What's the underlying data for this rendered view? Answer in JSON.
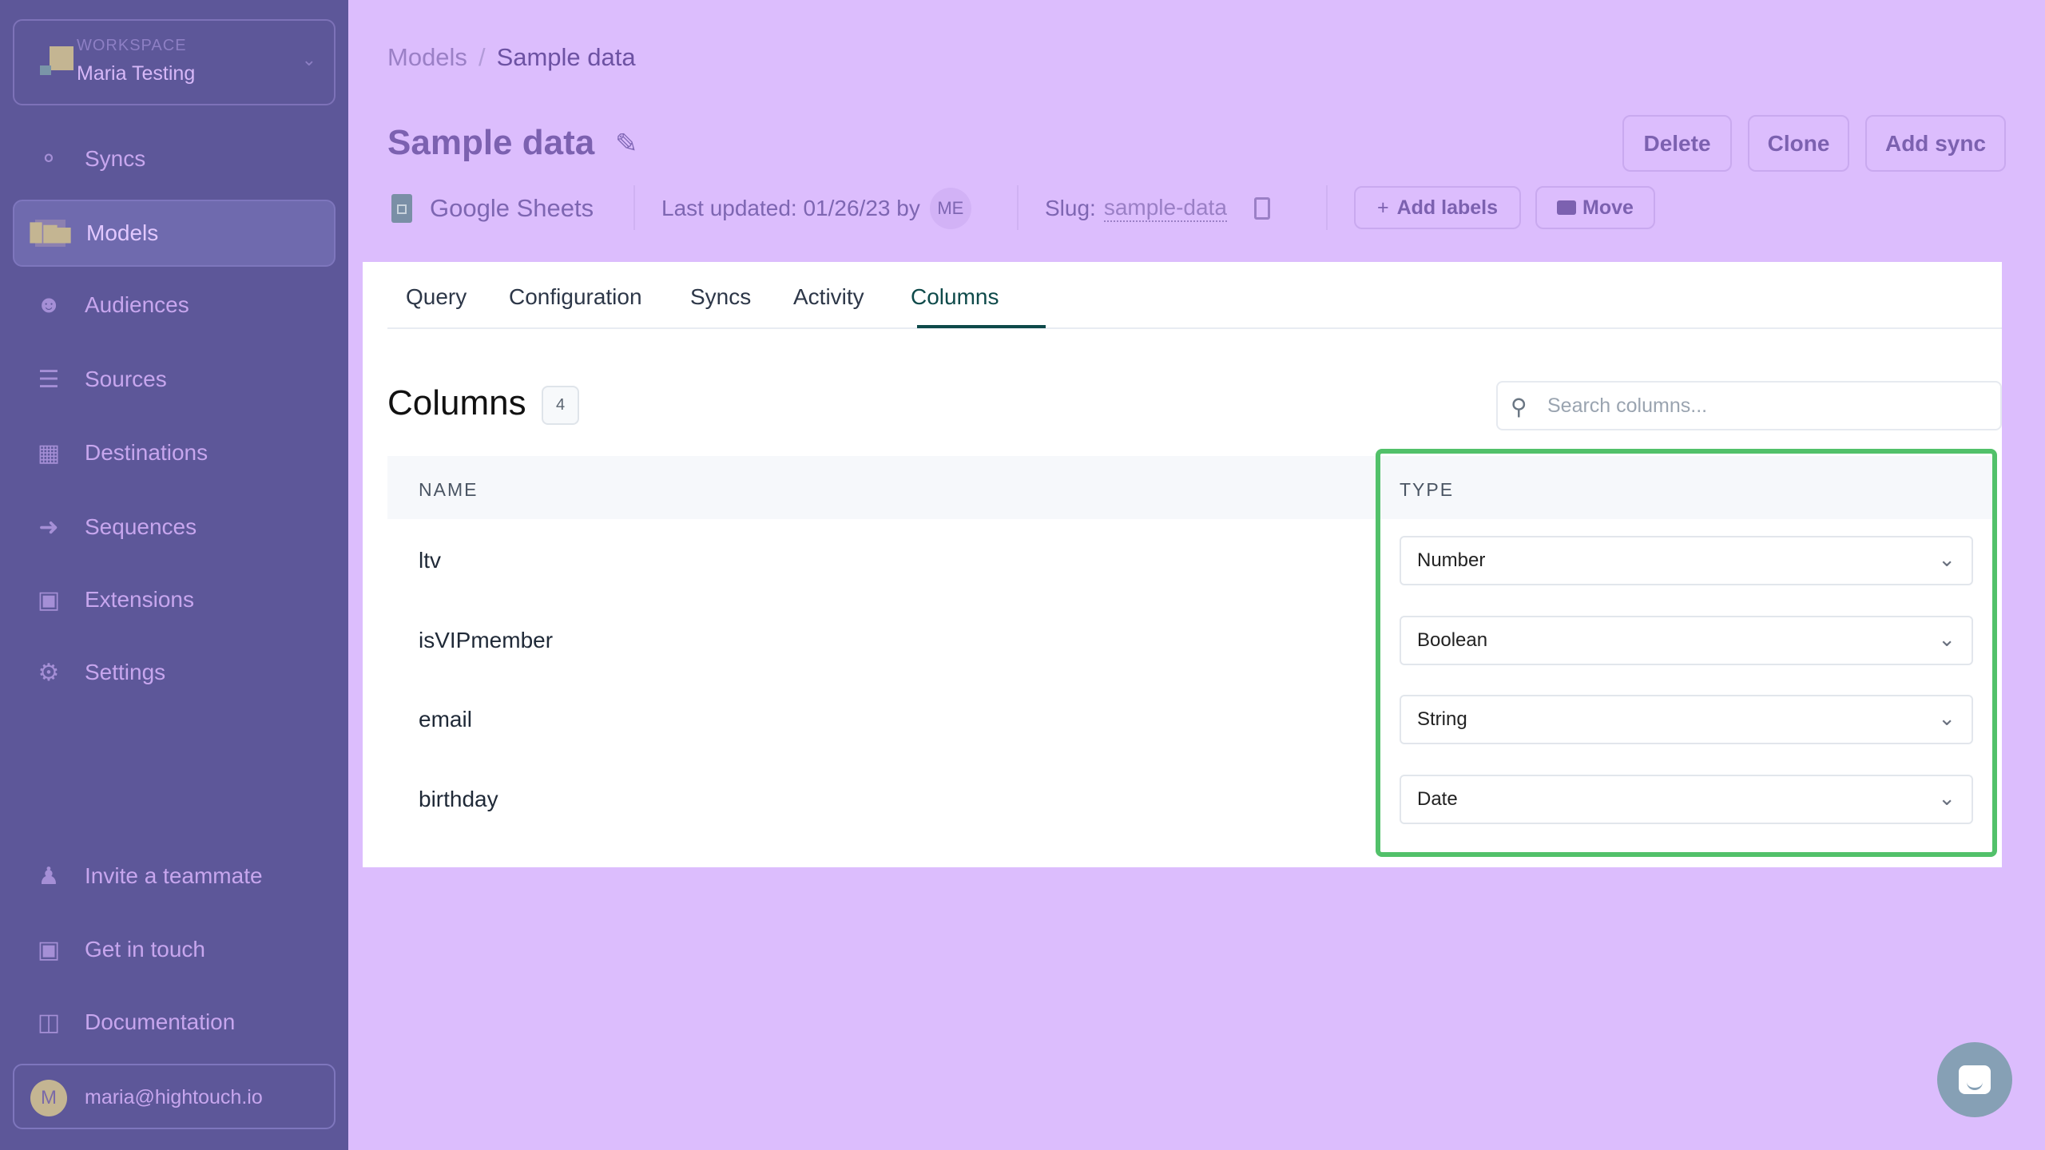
{
  "sidebar": {
    "workspace": {
      "label": "WORKSPACE",
      "name": "Maria Testing"
    },
    "items": [
      {
        "label": "Syncs",
        "icon": "syncs-icon"
      },
      {
        "label": "Models",
        "icon": "models-icon",
        "active": true
      },
      {
        "label": "Audiences",
        "icon": "audiences-icon"
      },
      {
        "label": "Sources",
        "icon": "database-icon"
      },
      {
        "label": "Destinations",
        "icon": "grid-icon"
      },
      {
        "label": "Sequences",
        "icon": "arrow-icon"
      },
      {
        "label": "Extensions",
        "icon": "briefcase-icon"
      },
      {
        "label": "Settings",
        "icon": "gear-icon"
      }
    ],
    "footer": [
      {
        "label": "Invite a teammate",
        "icon": "add-user-icon"
      },
      {
        "label": "Get in touch",
        "icon": "chat-icon"
      },
      {
        "label": "Documentation",
        "icon": "book-icon"
      }
    ],
    "user": {
      "initial": "M",
      "email": "maria@hightouch.io"
    }
  },
  "breadcrumb": {
    "parent": "Models",
    "separator": "/",
    "current": "Sample data"
  },
  "header": {
    "title": "Sample data",
    "source": "Google Sheets",
    "last_updated": "Last updated: 01/26/23 by",
    "updated_by": "ME",
    "slug_label": "Slug:",
    "slug": "sample-data",
    "add_labels": "Add labels",
    "move": "Move",
    "delete": "Delete",
    "clone": "Clone",
    "add_sync": "Add sync"
  },
  "tabs": [
    "Query",
    "Configuration",
    "Syncs",
    "Activity",
    "Columns"
  ],
  "active_tab": "Columns",
  "columns": {
    "heading": "Columns",
    "count": "4",
    "search_placeholder": "Search columns...",
    "headers": {
      "name": "NAME",
      "type": "TYPE"
    },
    "rows": [
      {
        "name": "ltv",
        "type": "Number"
      },
      {
        "name": "isVIPmember",
        "type": "Boolean"
      },
      {
        "name": "email",
        "type": "String"
      },
      {
        "name": "birthday",
        "type": "Date"
      }
    ]
  },
  "colors": {
    "highlight": "#52c16a",
    "sidebar": "#5d5799",
    "active_tab": "#0e4a4a"
  }
}
